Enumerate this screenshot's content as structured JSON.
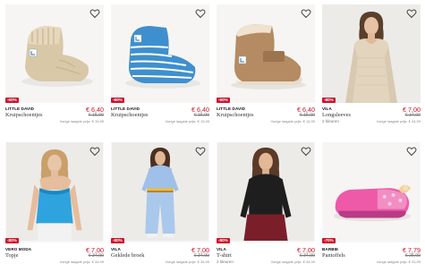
{
  "products": [
    {
      "brand": "LITTLE DAVID",
      "name": "Kruipschoentjes",
      "discount": "-60%",
      "price": "€ 6,40",
      "old_price": "€ 15,99",
      "prev_price": "Vorige laagste prijs: € 15,99",
      "sizes": ""
    },
    {
      "brand": "LITTLE DAVID",
      "name": "Kruipschoentjes",
      "discount": "-60%",
      "price": "€ 6,40",
      "old_price": "€ 15,99",
      "prev_price": "Vorige laagste prijs: € 15,99",
      "sizes": ""
    },
    {
      "brand": "LITTLE DAVID",
      "name": "Kruipschoentjes",
      "discount": "-60%",
      "price": "€ 6,40",
      "old_price": "€ 15,99",
      "prev_price": "Vorige laagste prijs: € 15,99",
      "sizes": ""
    },
    {
      "brand": "VILA",
      "name": "Longsleeves",
      "discount": "-80%",
      "price": "€ 7,00",
      "old_price": "€ 34,99",
      "prev_price": "Vorige laagste prijs: € 34,99",
      "sizes": "2 kleuren"
    },
    {
      "brand": "VERO MODA",
      "name": "Topje",
      "discount": "-80%",
      "price": "€ 7,00",
      "old_price": "€ 34,99",
      "prev_price": "Vorige laagste prijs: € 34,99",
      "sizes": ""
    },
    {
      "brand": "VILA",
      "name": "Geklede broek",
      "discount": "-80%",
      "price": "€ 7,00",
      "old_price": "€ 34,99",
      "prev_price": "Vorige laagste prijs: € 34,99",
      "sizes": ""
    },
    {
      "brand": "VILA",
      "name": "T-shirt",
      "discount": "-80%",
      "price": "€ 7,00",
      "old_price": "€ 34,99",
      "prev_price": "Vorige laagste prijs: € 34,99",
      "sizes": "2 kleuren"
    },
    {
      "brand": "BARBIE",
      "name": "Pantoffels",
      "discount": "-70%",
      "price": "€ 7,79",
      "old_price": "€ 25,99",
      "prev_price": "Vorige laagste prijs: € 25,99",
      "sizes": ""
    }
  ],
  "icons": {
    "favorite": "heart-outline-icon"
  },
  "colors": {
    "sale_red": "#d0112b"
  }
}
